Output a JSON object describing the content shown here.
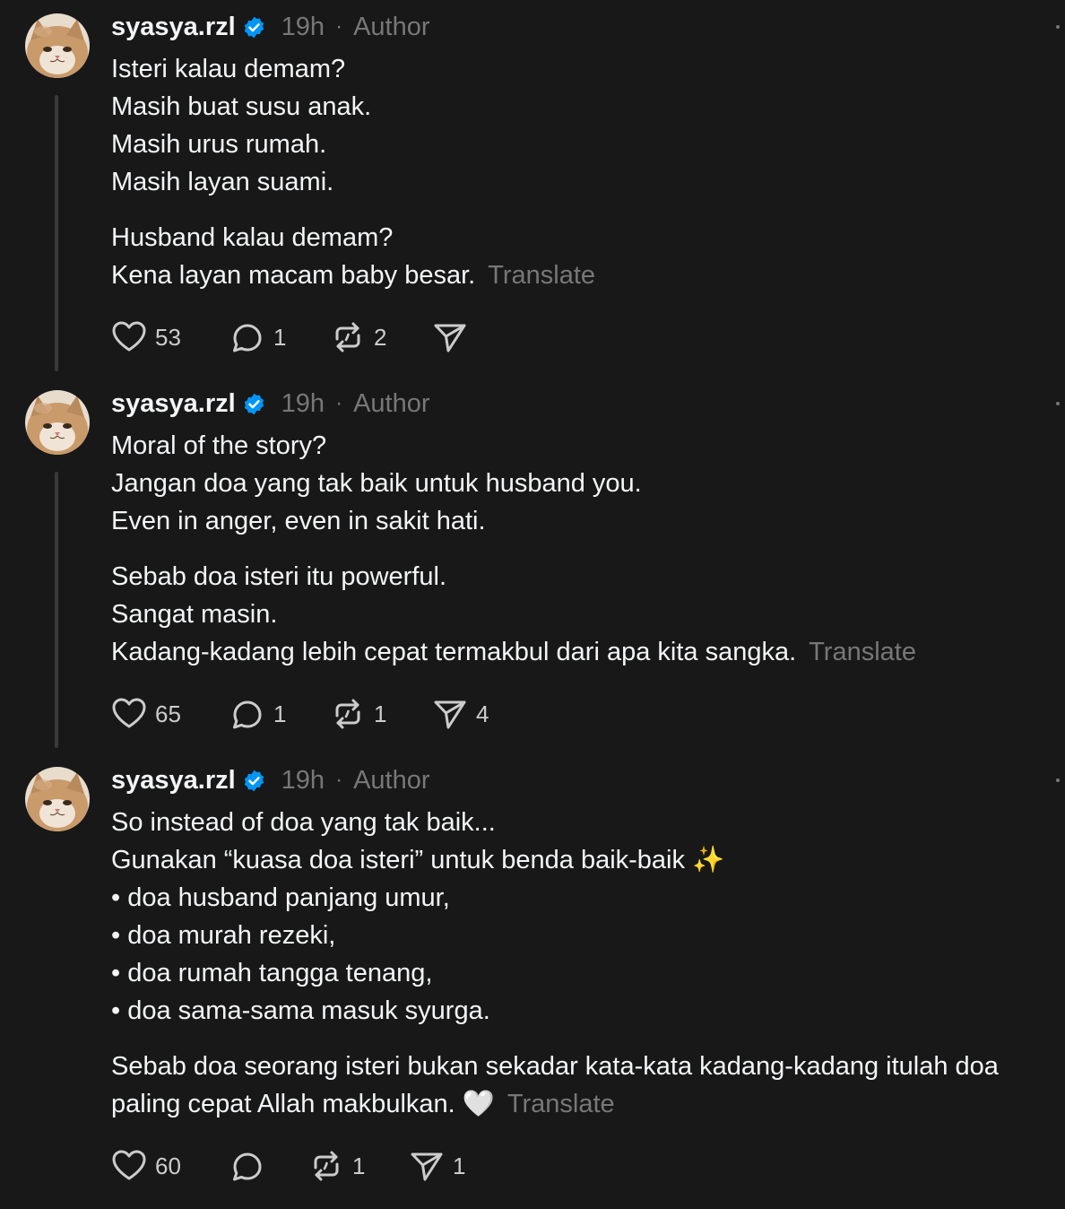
{
  "posts": [
    {
      "username": "syasya.rzl",
      "time": "19h",
      "role": "Author",
      "lines": [
        "Isteri kalau demam?",
        "Masih buat susu anak.",
        "Masih urus rumah.",
        "Masih layan suami.",
        "Husband kalau demam?",
        "Kena layan macam baby besar."
      ],
      "translate": "Translate",
      "likes": "53",
      "replies": "1",
      "reposts": "2",
      "shares": ""
    },
    {
      "username": "syasya.rzl",
      "time": "19h",
      "role": "Author",
      "lines": [
        "Moral of the story?",
        "Jangan doa yang tak baik untuk husband you.",
        "Even in anger, even in sakit hati.",
        "Sebab doa isteri itu powerful.",
        "Sangat masin.",
        "Kadang-kadang lebih cepat termakbul dari apa kita sangka."
      ],
      "translate": "Translate",
      "likes": "65",
      "replies": "1",
      "reposts": "1",
      "shares": "4"
    },
    {
      "username": "syasya.rzl",
      "time": "19h",
      "role": "Author",
      "lines": [
        "So instead of doa yang tak baik...",
        "Gunakan “kuasa doa isteri” untuk benda baik-baik ✨",
        "• doa husband panjang umur,",
        "• doa murah rezeki,",
        "• doa rumah tangga tenang,",
        "• doa sama-sama masuk syurga.",
        "Sebab doa seorang isteri bukan sekadar kata-kata kadang-kadang itulah doa paling cepat Allah makbulkan. 🤍"
      ],
      "translate": "Translate",
      "likes": "60",
      "replies": "",
      "reposts": "1",
      "shares": "1"
    }
  ],
  "colors": {
    "background": "#181818",
    "text": "#f3f5f7",
    "muted": "#777777",
    "verified": "#0095f6",
    "thread_line": "#3a3a3a"
  },
  "icons": [
    "verified-badge-icon",
    "heart-icon",
    "reply-icon",
    "repost-icon",
    "share-icon",
    "more-icon"
  ]
}
